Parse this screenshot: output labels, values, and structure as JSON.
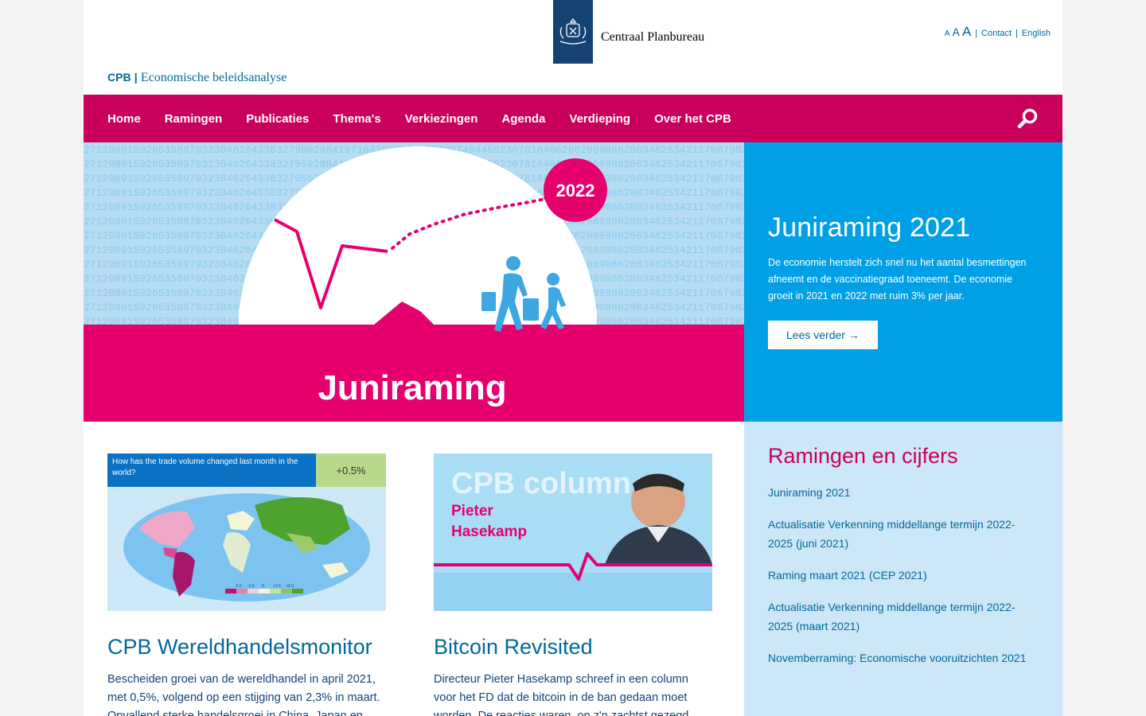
{
  "header": {
    "org_name": "Centraal Planbureau",
    "brand_short": "CPB",
    "brand_divider": "|",
    "brand_tagline": "Economische beleidsanalyse",
    "font_small": "A",
    "font_medium": "A",
    "font_large": "A",
    "sep": "|",
    "contact": "Contact",
    "english": "English"
  },
  "nav": {
    "items": [
      "Home",
      "Ramingen",
      "Publicaties",
      "Thema's",
      "Verkiezingen",
      "Agenda",
      "Verdieping",
      "Over het CPB"
    ]
  },
  "hero": {
    "image_year": "2022",
    "image_caption": "Juniraming",
    "title": "Juniraming 2021",
    "text": "De economie herstelt zich snel nu het aantal besmettingen afneemt en de vaccinatiegraad toeneemt. De economie groeit in 2021 en 2022 met ruim 3% per jaar.",
    "button": "Lees verder →"
  },
  "cards": [
    {
      "image_question": "How has the trade volume changed last month in the world?",
      "image_value": "+0.5%",
      "legend": [
        "-2.0",
        "-1.5",
        "0",
        "+1.5",
        "+2.0"
      ],
      "title": "CPB Wereldhandelsmonitor",
      "text": "Bescheiden groei van de wereldhandel in april 2021, met 0,5%, volgend op een stijging van 2,3% in maart. Opvallend sterke handelsgroei in China, Japan en"
    },
    {
      "image_heading": "CPB column",
      "image_name_1": "Pieter",
      "image_name_2": "Hasekamp",
      "title": "Bitcoin Revisited",
      "text": "Directeur Pieter Hasekamp schreef in een column voor het FD dat de bitcoin in de ban gedaan moet worden. De reacties waren, op z'n zachtst gezegd"
    }
  ],
  "sidebar": {
    "title": "Ramingen en cijfers",
    "links": [
      "Juniraming 2021",
      "Actualisatie Verkenning middellange termijn 2022-2025 (juni 2021)",
      "Raming maart 2021 (CEP 2021)",
      "Actualisatie Verkenning middellange termijn 2022-2025 (maart 2021)",
      "Novemberraming: Economische vooruitzichten 2021"
    ]
  },
  "colors": {
    "magenta": "#ca005d",
    "cyan": "#00a0e6",
    "light_blue": "#cce7f7",
    "link_blue": "#01689b",
    "logo_blue": "#154273"
  },
  "icons": {
    "search": "magnifier-icon",
    "logo": "coat-of-arms-icon"
  }
}
